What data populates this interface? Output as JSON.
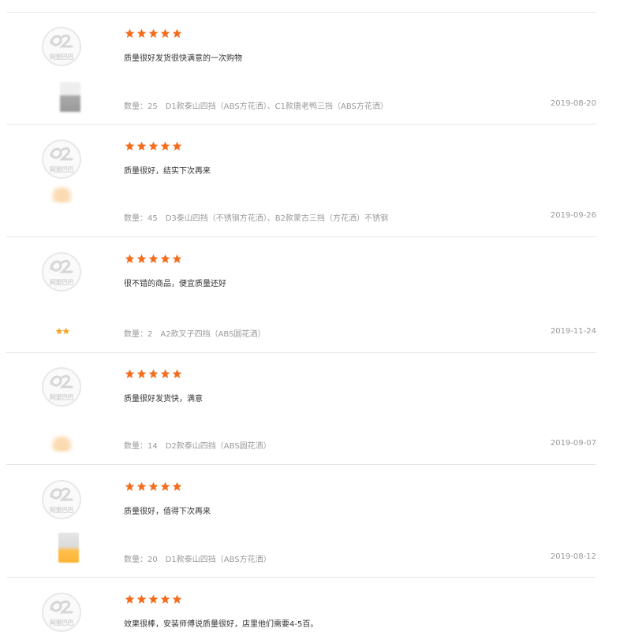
{
  "reviews": [
    {
      "rating": 5,
      "content": "质量很好发货很快满意的一次购物",
      "quantity_label": "数量：",
      "quantity": "25",
      "spec": "D1款泰山四挡（ABS方花洒）、C1款唐老鸭三挡（ABS方花洒）",
      "date": "2019-08-20",
      "thumbnail": "gray"
    },
    {
      "rating": 5,
      "content": "质量很好，结实下次再来",
      "quantity_label": "数量：",
      "quantity": "45",
      "spec": "D3泰山四挡（不锈钢方花洒）、B2款蒙古三挡（方花洒）不锈钢",
      "date": "2019-09-26",
      "thumbnail": "orange"
    },
    {
      "rating": 5,
      "content": "很不错的商品，便宜质量还好",
      "quantity_label": "数量：",
      "quantity": "2",
      "spec": "A2款叉子四挡（ABS圆花洒）",
      "date": "2019-11-24",
      "thumbnail": "stars"
    },
    {
      "rating": 5,
      "content": "质量很好发货快，满意",
      "quantity_label": "数量：",
      "quantity": "14",
      "spec": "D2款泰山四挡（ABS圆花洒）",
      "date": "2019-09-07",
      "thumbnail": "orange"
    },
    {
      "rating": 5,
      "content": "质量很好，值得下次再来",
      "quantity_label": "数量：",
      "quantity": "20",
      "spec": "D1款泰山四挡（ABS方花洒）",
      "date": "2019-08-12",
      "thumbnail": "cup"
    },
    {
      "rating": 5,
      "content": "效果很棒，安装师傅说质量很好，店里他们需要4-5百。",
      "quantity_label": "",
      "quantity": "",
      "spec": "",
      "date": "",
      "thumbnail": "none"
    }
  ],
  "logo": {
    "icon": "alibaba-logo-icon",
    "text": "阿里巴巴"
  },
  "colors": {
    "star": "#f56c1c",
    "divider": "#e6e6e6",
    "meta_text": "#999999",
    "content_text": "#333333"
  }
}
